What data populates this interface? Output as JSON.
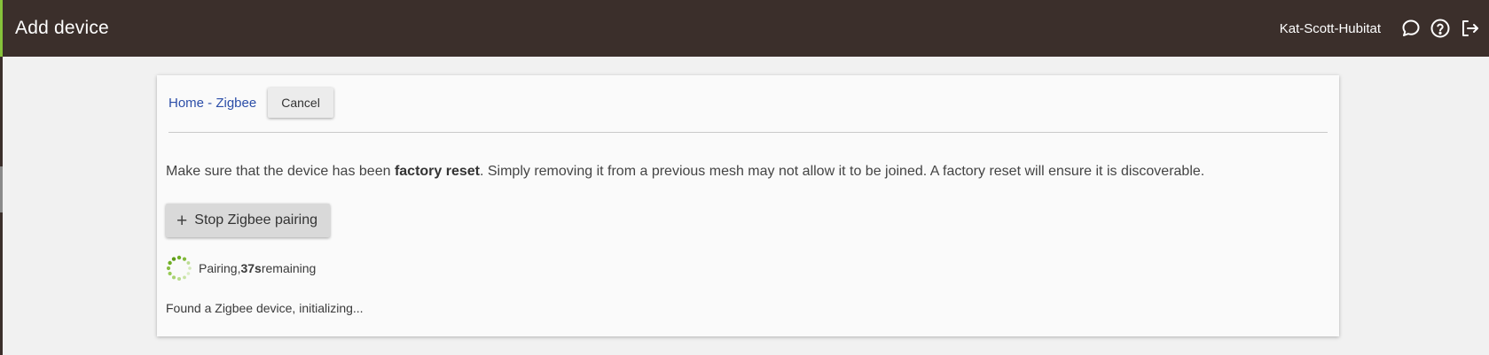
{
  "header": {
    "title": "Add device",
    "hub_name": "Kat-Scott-Hubitat",
    "icons": [
      "chat-icon",
      "help-icon",
      "logout-icon"
    ]
  },
  "card": {
    "breadcrumb": "Home - Zigbee",
    "cancel_label": "Cancel",
    "instructions": {
      "before": "Make sure that the device has been ",
      "bold": "factory reset",
      "after": ". Simply removing it from a previous mesh may not allow it to be joined. A factory reset will ensure it is discoverable."
    },
    "stop_button_label": "Stop Zigbee pairing",
    "pairing": {
      "prefix": "Pairing, ",
      "time": "37s",
      "suffix": " remaining"
    },
    "status": "Found a Zigbee device, initializing..."
  },
  "colors": {
    "topbar": "#3b2f2b",
    "accent": "#86c23a",
    "link": "#2c4ea8"
  }
}
